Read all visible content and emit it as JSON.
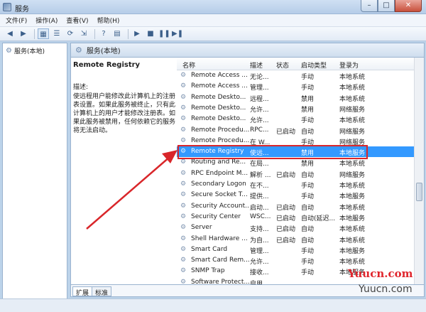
{
  "window": {
    "title": "服务",
    "btn_min": "–",
    "btn_max": "□",
    "btn_close": "✕"
  },
  "menu": [
    "文件(F)",
    "操作(A)",
    "查看(V)",
    "帮助(H)"
  ],
  "toolbar_icons": [
    "back-icon",
    "forward-icon",
    "console-tree-icon",
    "list-icon",
    "refresh-icon",
    "export-icon",
    "properties-icon",
    "help-icon",
    "mmc-icon",
    "start-icon",
    "stop-icon",
    "pause-icon",
    "restart-icon"
  ],
  "left_tree": {
    "item": "服务(本地)"
  },
  "main_header": "服务(本地)",
  "description": {
    "title": "Remote Registry",
    "label": "描述:",
    "text": "使远程用户能修改此计算机上的注册表设置。如果此服务被终止，只有此计算机上的用户才能修改注册表。如果此服务被禁用，任何依赖它的服务将无法启动。"
  },
  "columns": [
    "名称",
    "描述",
    "状态",
    "启动类型",
    "登录为"
  ],
  "rows": [
    {
      "name": "Remote Access ...",
      "desc": "无论...",
      "status": "",
      "startup": "手动",
      "logon": "本地系统"
    },
    {
      "name": "Remote Access ...",
      "desc": "管理...",
      "status": "",
      "startup": "手动",
      "logon": "本地系统"
    },
    {
      "name": "Remote Deskto...",
      "desc": "远程...",
      "status": "",
      "startup": "禁用",
      "logon": "本地系统"
    },
    {
      "name": "Remote Deskto...",
      "desc": "允许...",
      "status": "",
      "startup": "禁用",
      "logon": "网络服务"
    },
    {
      "name": "Remote Deskto...",
      "desc": "允许...",
      "status": "",
      "startup": "手动",
      "logon": "本地系统"
    },
    {
      "name": "Remote Procedu...",
      "desc": "RPC...",
      "status": "已启动",
      "startup": "自动",
      "logon": "网络服务"
    },
    {
      "name": "Remote Procedu...",
      "desc": "在 W...",
      "status": "",
      "startup": "手动",
      "logon": "网络服务"
    },
    {
      "name": "Remote Registry",
      "desc": "使远...",
      "status": "",
      "startup": "禁用",
      "logon": "本地服务",
      "selected": true
    },
    {
      "name": "Routing and Re...",
      "desc": "在局...",
      "status": "",
      "startup": "禁用",
      "logon": "本地系统"
    },
    {
      "name": "RPC Endpoint M...",
      "desc": "解析 ...",
      "status": "已启动",
      "startup": "自动",
      "logon": "网络服务"
    },
    {
      "name": "Secondary Logon",
      "desc": "在不...",
      "status": "",
      "startup": "手动",
      "logon": "本地系统"
    },
    {
      "name": "Secure Socket T...",
      "desc": "提供...",
      "status": "",
      "startup": "手动",
      "logon": "本地服务"
    },
    {
      "name": "Security Account...",
      "desc": "启动...",
      "status": "已启动",
      "startup": "自动",
      "logon": "本地系统"
    },
    {
      "name": "Security Center",
      "desc": "WSC...",
      "status": "已启动",
      "startup": "自动(延迟...",
      "logon": "本地服务"
    },
    {
      "name": "Server",
      "desc": "支持...",
      "status": "已启动",
      "startup": "自动",
      "logon": "本地系统"
    },
    {
      "name": "Shell Hardware ...",
      "desc": "为自...",
      "status": "已启动",
      "startup": "自动",
      "logon": "本地系统"
    },
    {
      "name": "Smart Card",
      "desc": "管理...",
      "status": "",
      "startup": "手动",
      "logon": "本地服务"
    },
    {
      "name": "Smart Card Rem...",
      "desc": "允许...",
      "status": "",
      "startup": "手动",
      "logon": "本地系统"
    },
    {
      "name": "SNMP Trap",
      "desc": "接收...",
      "status": "",
      "startup": "手动",
      "logon": "本地服务"
    },
    {
      "name": "Software Protect...",
      "desc": "启用...",
      "status": "",
      "startup": "",
      "logon": ""
    }
  ],
  "tabs": [
    "扩展",
    "标准"
  ],
  "watermark": {
    "brand": "Yuucn.com",
    "sub": "Yuucn.com"
  },
  "colors": {
    "selection": "#3399ff",
    "highlight_box": "#d9262a"
  }
}
